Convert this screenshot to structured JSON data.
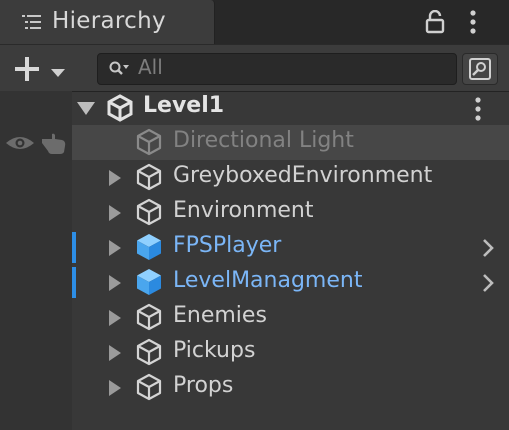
{
  "window": {
    "tab_title": "Hierarchy",
    "tab_icon": "hierarchy-list-icon",
    "lock_icon": "lock-icon",
    "menu_icon": "kebab-menu-icon"
  },
  "toolbar": {
    "add_icon": "plus-icon",
    "dropdown_icon": "dropdown-arrow-icon",
    "search_placeholder": "All",
    "search_icon": "search-icon",
    "search_mode_icon": "scene-search-icon"
  },
  "scene": {
    "name": "Level1",
    "expanded": true,
    "icon": "unity-scene-icon",
    "menu_icon": "kebab-menu-icon"
  },
  "items": [
    {
      "label": "Directional Light",
      "type": "gameobject",
      "disabled": true,
      "has_children": false,
      "selected": true
    },
    {
      "label": "GreyboxedEnvironment",
      "type": "gameobject",
      "disabled": false,
      "has_children": true
    },
    {
      "label": "Environment",
      "type": "gameobject",
      "disabled": false,
      "has_children": true
    },
    {
      "label": "FPSPlayer",
      "type": "prefab",
      "disabled": false,
      "has_children": true,
      "prefab_chevron": true
    },
    {
      "label": "LevelManagment",
      "type": "prefab",
      "disabled": false,
      "has_children": true,
      "prefab_chevron": true
    },
    {
      "label": "Enemies",
      "type": "gameobject",
      "disabled": false,
      "has_children": true
    },
    {
      "label": "Pickups",
      "type": "gameobject",
      "disabled": false,
      "has_children": true
    },
    {
      "label": "Props",
      "type": "gameobject",
      "disabled": false,
      "has_children": true
    }
  ],
  "colors": {
    "background": "#383838",
    "prefab_text": "#7bb6f7",
    "prefab_bar": "#2d8ee6",
    "disabled_text": "#828282",
    "selected_row": "#474747"
  }
}
